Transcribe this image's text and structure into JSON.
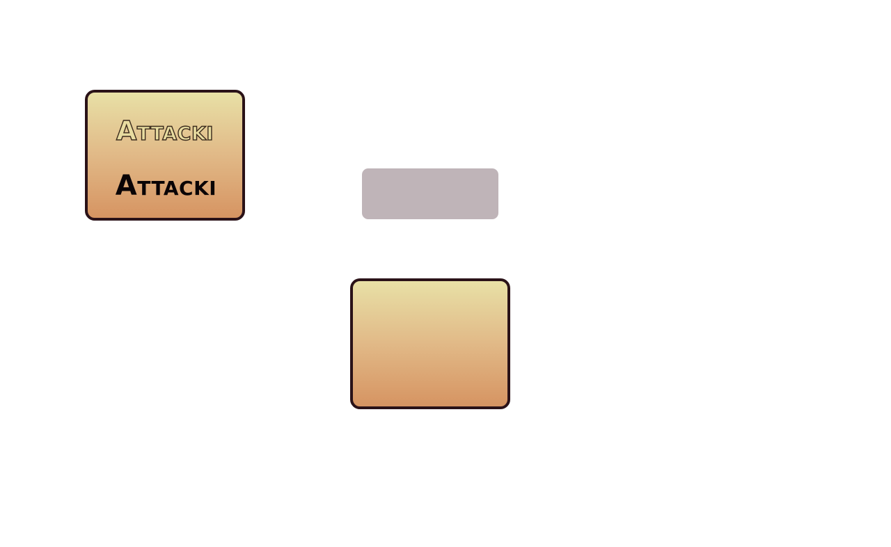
{
  "cards": {
    "top": {
      "outlined_label": "Attacki",
      "solid_label": "Attacki"
    }
  },
  "colors": {
    "card_gradient_top": "#e8e0a6",
    "card_gradient_bottom": "#d69462",
    "card_border": "#2a1218",
    "outlined_text_fill": "#e8dca0",
    "outlined_text_stroke": "#3a2a1c",
    "solid_text": "#0a0406",
    "grey_plate": "#bfb4b8",
    "background": "#ffffff"
  }
}
